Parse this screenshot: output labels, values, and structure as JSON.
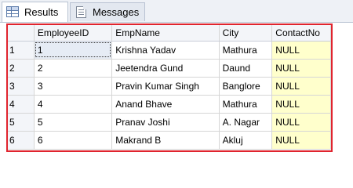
{
  "tabs": [
    {
      "label": "Results",
      "icon": "grid-icon",
      "active": true
    },
    {
      "label": "Messages",
      "icon": "messages-icon",
      "active": false
    }
  ],
  "grid": {
    "columns": [
      "",
      "EmployeeID",
      "EmpName",
      "City",
      "ContactNo"
    ],
    "rows": [
      {
        "rownum": "1",
        "EmployeeID": "1",
        "EmpName": "Krishna Yadav",
        "City": "Mathura",
        "ContactNo": "NULL"
      },
      {
        "rownum": "2",
        "EmployeeID": "2",
        "EmpName": "Jeetendra Gund",
        "City": "Daund",
        "ContactNo": "NULL"
      },
      {
        "rownum": "3",
        "EmployeeID": "3",
        "EmpName": "Pravin Kumar Singh",
        "City": "Banglore",
        "ContactNo": "NULL"
      },
      {
        "rownum": "4",
        "EmployeeID": "4",
        "EmpName": "Anand Bhave",
        "City": "Mathura",
        "ContactNo": "NULL"
      },
      {
        "rownum": "5",
        "EmployeeID": "5",
        "EmpName": "Pranav Joshi",
        "City": "A. Nagar",
        "ContactNo": "NULL"
      },
      {
        "rownum": "6",
        "EmployeeID": "6",
        "EmpName": "Makrand B",
        "City": "Akluj",
        "ContactNo": "NULL"
      }
    ]
  },
  "colors": {
    "highlight_border": "#e0242e",
    "null_cell": "#ffffcc",
    "header_bg": "#f3f5f9"
  }
}
